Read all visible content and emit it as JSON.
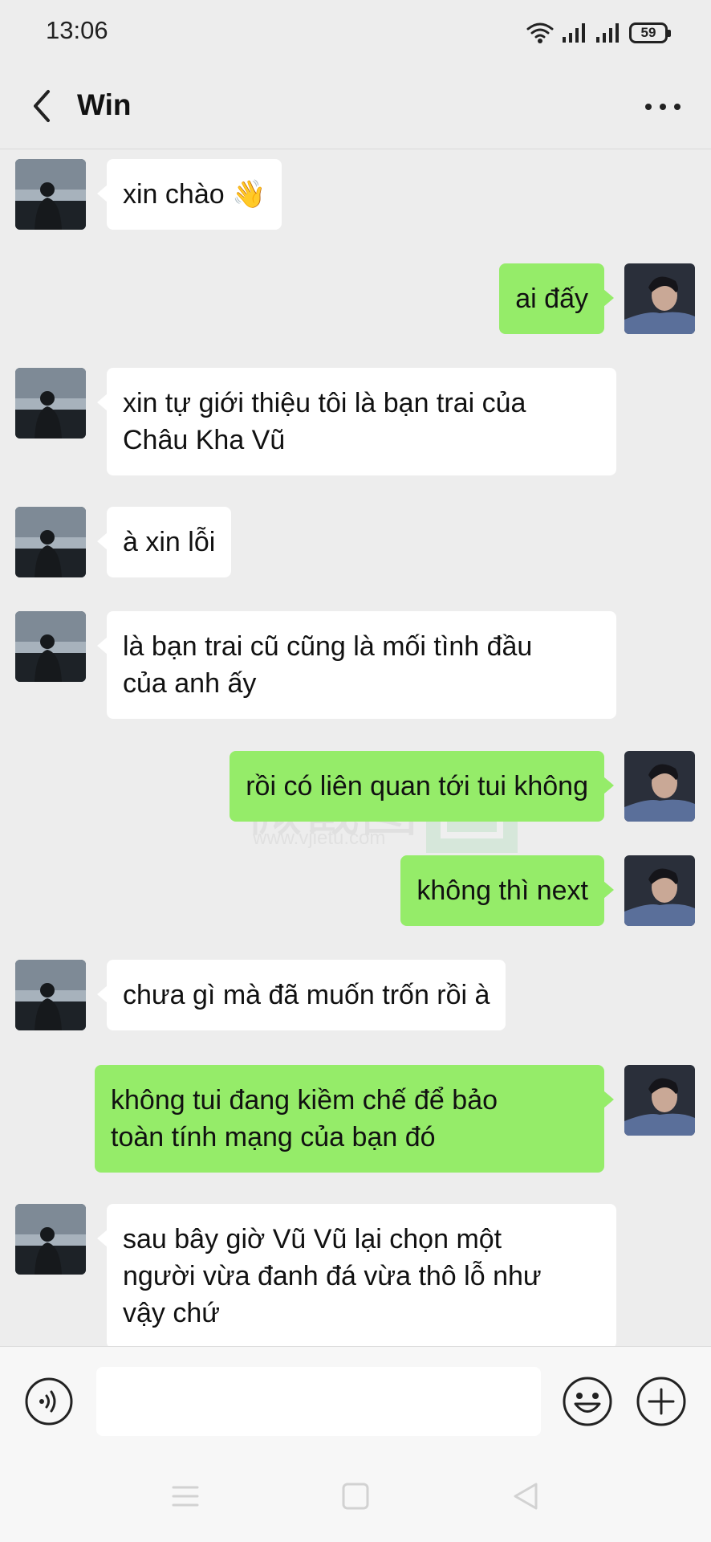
{
  "status_bar": {
    "time": "13:06",
    "battery": "59",
    "icons": [
      "wifi-icon",
      "signal-icon",
      "signal-icon",
      "battery-icon"
    ]
  },
  "header": {
    "title": "Win",
    "back_icon": "chevron-left-icon",
    "more_icon": "more-icon"
  },
  "colors": {
    "background": "#ededed",
    "incoming_bubble": "#ffffff",
    "outgoing_bubble": "#95ec69",
    "input_bar": "#f7f7f7"
  },
  "messages": [
    {
      "side": "incoming",
      "lines": [
        "xin chào 👋"
      ]
    },
    {
      "side": "outgoing",
      "lines": [
        "ai đấy"
      ]
    },
    {
      "side": "incoming",
      "lines": [
        "xin tự giới thiệu tôi là bạn trai của",
        "Châu Kha Vũ"
      ]
    },
    {
      "side": "incoming",
      "lines": [
        "à xin lỗi"
      ]
    },
    {
      "side": "incoming",
      "lines": [
        "là bạn trai cũ cũng là mối tình đầu",
        "của anh ấy"
      ]
    },
    {
      "side": "outgoing",
      "lines": [
        "rồi có liên quan tới tui không"
      ]
    },
    {
      "side": "outgoing",
      "lines": [
        "không thì next"
      ]
    },
    {
      "side": "incoming",
      "lines": [
        "chưa gì mà đã muốn trốn rồi à"
      ]
    },
    {
      "side": "outgoing",
      "lines": [
        "không tui đang kiềm chế để bảo",
        "toàn tính mạng của bạn đó"
      ]
    },
    {
      "side": "incoming",
      "lines": [
        "sau bây giờ Vũ Vũ lại chọn một",
        "người vừa đanh đá vừa thô lỗ như",
        "vậy chứ"
      ]
    }
  ],
  "watermark": {
    "text": "微截图",
    "url": "www.vjietu.com"
  },
  "input_bar": {
    "placeholder": "",
    "value": "",
    "voice_icon": "voice-icon",
    "emoji_icon": "emoji-icon",
    "plus_icon": "plus-icon"
  },
  "nav_bar": {
    "icons": [
      "menu-icon",
      "home-square-icon",
      "back-triangle-icon"
    ]
  }
}
